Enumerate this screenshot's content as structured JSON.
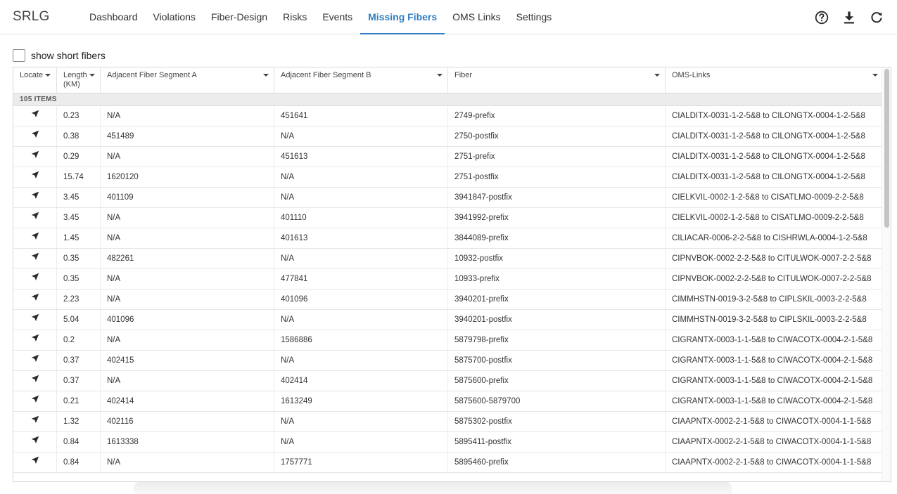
{
  "app": {
    "title": "SRLG"
  },
  "nav": {
    "tabs": [
      {
        "label": "Dashboard",
        "active": false
      },
      {
        "label": "Violations",
        "active": false
      },
      {
        "label": "Fiber-Design",
        "active": false
      },
      {
        "label": "Risks",
        "active": false
      },
      {
        "label": "Events",
        "active": false
      },
      {
        "label": "Missing Fibers",
        "active": true
      },
      {
        "label": "OMS Links",
        "active": false
      },
      {
        "label": "Settings",
        "active": false
      }
    ],
    "accent_color": "#2f7ec4"
  },
  "actions": [
    {
      "icon": "help-icon"
    },
    {
      "icon": "download-icon"
    },
    {
      "icon": "refresh-icon"
    }
  ],
  "filter": {
    "label": "show short fibers",
    "checked": false
  },
  "table": {
    "columns": {
      "locate": "Locate",
      "length_line1": "Length",
      "length_line2": "(KM)",
      "seg_a": "Adjacent Fiber Segment A",
      "seg_b": "Adjacent Fiber Segment B",
      "fiber": "Fiber",
      "oms": "OMS-Links"
    },
    "group_label": "105 ITEMS",
    "rows": [
      {
        "length": "0.23",
        "seg_a": "N/A",
        "seg_b": "451641",
        "fiber": "2749-prefix",
        "oms": "CIALDITX-0031-1-2-5&8 to CILONGTX-0004-1-2-5&8"
      },
      {
        "length": "0.38",
        "seg_a": "451489",
        "seg_b": "N/A",
        "fiber": "2750-postfix",
        "oms": "CIALDITX-0031-1-2-5&8 to CILONGTX-0004-1-2-5&8"
      },
      {
        "length": "0.29",
        "seg_a": "N/A",
        "seg_b": "451613",
        "fiber": "2751-prefix",
        "oms": "CIALDITX-0031-1-2-5&8 to CILONGTX-0004-1-2-5&8"
      },
      {
        "length": "15.74",
        "seg_a": "1620120",
        "seg_b": "N/A",
        "fiber": "2751-postfix",
        "oms": "CIALDITX-0031-1-2-5&8 to CILONGTX-0004-1-2-5&8"
      },
      {
        "length": "3.45",
        "seg_a": "401109",
        "seg_b": "N/A",
        "fiber": "3941847-postfix",
        "oms": "CIELKVIL-0002-1-2-5&8 to CISATLMO-0009-2-2-5&8"
      },
      {
        "length": "3.45",
        "seg_a": "N/A",
        "seg_b": "401110",
        "fiber": "3941992-prefix",
        "oms": "CIELKVIL-0002-1-2-5&8 to CISATLMO-0009-2-2-5&8"
      },
      {
        "length": "1.45",
        "seg_a": "N/A",
        "seg_b": "401613",
        "fiber": "3844089-prefix",
        "oms": "CILIACAR-0006-2-2-5&8 to CISHRWLA-0004-1-2-5&8"
      },
      {
        "length": "0.35",
        "seg_a": "482261",
        "seg_b": "N/A",
        "fiber": "10932-postfix",
        "oms": "CIPNVBOK-0002-2-2-5&8 to CITULWOK-0007-2-2-5&8"
      },
      {
        "length": "0.35",
        "seg_a": "N/A",
        "seg_b": "477841",
        "fiber": "10933-prefix",
        "oms": "CIPNVBOK-0002-2-2-5&8 to CITULWOK-0007-2-2-5&8"
      },
      {
        "length": "2.23",
        "seg_a": "N/A",
        "seg_b": "401096",
        "fiber": "3940201-prefix",
        "oms": "CIMMHSTN-0019-3-2-5&8 to CIPLSKIL-0003-2-2-5&8"
      },
      {
        "length": "5.04",
        "seg_a": "401096",
        "seg_b": "N/A",
        "fiber": "3940201-postfix",
        "oms": "CIMMHSTN-0019-3-2-5&8 to CIPLSKIL-0003-2-2-5&8"
      },
      {
        "length": "0.2",
        "seg_a": "N/A",
        "seg_b": "1586886",
        "fiber": "5879798-prefix",
        "oms": "CIGRANTX-0003-1-1-5&8 to CIWACOTX-0004-2-1-5&8"
      },
      {
        "length": "0.37",
        "seg_a": "402415",
        "seg_b": "N/A",
        "fiber": "5875700-postfix",
        "oms": "CIGRANTX-0003-1-1-5&8 to CIWACOTX-0004-2-1-5&8"
      },
      {
        "length": "0.37",
        "seg_a": "N/A",
        "seg_b": "402414",
        "fiber": "5875600-prefix",
        "oms": "CIGRANTX-0003-1-1-5&8 to CIWACOTX-0004-2-1-5&8"
      },
      {
        "length": "0.21",
        "seg_a": "402414",
        "seg_b": "1613249",
        "fiber": "5875600-5879700",
        "oms": "CIGRANTX-0003-1-1-5&8 to CIWACOTX-0004-2-1-5&8"
      },
      {
        "length": "1.32",
        "seg_a": "402116",
        "seg_b": "N/A",
        "fiber": "5875302-postfix",
        "oms": "CIAAPNTX-0002-2-1-5&8 to CIWACOTX-0004-1-1-5&8"
      },
      {
        "length": "0.84",
        "seg_a": "1613338",
        "seg_b": "N/A",
        "fiber": "5895411-postfix",
        "oms": "CIAAPNTX-0002-2-1-5&8 to CIWACOTX-0004-1-1-5&8"
      },
      {
        "length": "0.84",
        "seg_a": "N/A",
        "seg_b": "1757771",
        "fiber": "5895460-prefix",
        "oms": "CIAAPNTX-0002-2-1-5&8 to CIWACOTX-0004-1-1-5&8"
      }
    ]
  }
}
